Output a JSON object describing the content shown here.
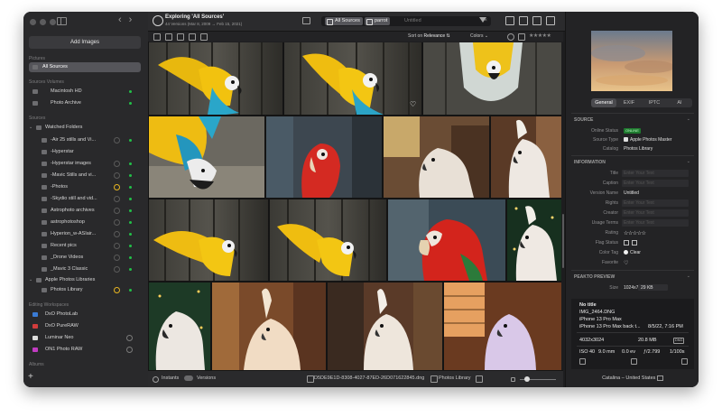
{
  "sidebar": {
    "add_images": "Add Images",
    "sections": {
      "pictures": "Pictures",
      "volumes": "Sources Volumes",
      "sources": "Sources",
      "editing": "Editing Workspaces",
      "albums": "Albums"
    },
    "pictures_item": "All Sources",
    "volumes": [
      "Macintosh HD",
      "Photo Archive"
    ],
    "watched_folders_label": "Watched Folders",
    "watched": [
      "-Air 25 stills and Vi...",
      "-Hyperstar",
      "-Hyperstar images",
      "-Mavic Stills and vi...",
      "-Photos",
      "-Skydio still and vid...",
      "Astrophoto archives",
      "astrophotoshop",
      "Hyperion_w-ASIair...",
      "Recent pics",
      "_Drone Videos",
      "_Mavic 3 Classic"
    ],
    "apple_libraries_label": "Apple Photos Libraries",
    "apple_items": [
      "Photos Library"
    ],
    "workspaces": [
      "DxO PhotoLab",
      "DxO PureRAW",
      "Luminar Neo",
      "ON1 Photo RAW"
    ],
    "add_symbol": "+"
  },
  "toolbar": {
    "title": "Exploring 'All Sources'",
    "subtitle": "44 Versions (Mar 8, 2009 → Feb 15, 2021)",
    "search_tag_1": "All Sources",
    "search_tag_2": "parrot",
    "search_rest": "Untitled",
    "clear_symbol": "×"
  },
  "subbar": {
    "sort_label": "Sort on",
    "sort_value": "Relevance ⇅",
    "colors_label": "Colors ⌄",
    "stars": "★★★★★"
  },
  "status": {
    "instants": "Instants",
    "versions": "Versions",
    "filename": "D5DE9E1D-8308-4027-87ED-26D071622845.dng",
    "library": "Photos Library"
  },
  "inspector": {
    "tabs": [
      "General",
      "EXIF",
      "IPTC",
      "AI"
    ],
    "source_header": "SOURCE",
    "online_status_label": "Online Status",
    "online_status_value": "ONLINE",
    "source_type_label": "Source Type",
    "source_type_value": "Apple Photos Master",
    "catalog_label": "Catalog",
    "catalog_value": "Photos Library",
    "information_header": "INFORMATION",
    "title_label": "Title",
    "caption_label": "Caption",
    "version_name_label": "Version Name",
    "version_name_value": "Untitled",
    "rights_label": "Rights",
    "creator_label": "Creator",
    "usage_terms_label": "Usage Terms",
    "rating_label": "Rating",
    "rating_value": "☆☆☆☆☆",
    "flag_status_label": "Flag Status",
    "color_tag_label": "Color Tag",
    "color_tag_value": "Clear",
    "favorite_label": "Favorite",
    "favorite_value": "♡",
    "peakto_header": "PEAKTO PREVIEW",
    "size_label": "Size",
    "size_value": "1024x768",
    "size_kb": "29 KB",
    "placeholder": "Enter Your Text",
    "details": {
      "title": "No title",
      "filename": "IMG_2464.DNG",
      "camera": "iPhone 13 Pro Max",
      "lens": "iPhone 13 Pro Max back t...",
      "date": "8/5/22, 7:16 PM",
      "dimensions": "4032x3024",
      "filesize": "20.8 MB",
      "format": "DNG",
      "iso": "ISO 40",
      "focal": "9.0 mm",
      "ev": "0.0 ev",
      "aperture": "ƒ/2.799",
      "shutter": "1/100s"
    },
    "location": "Catalina  –  United States"
  }
}
